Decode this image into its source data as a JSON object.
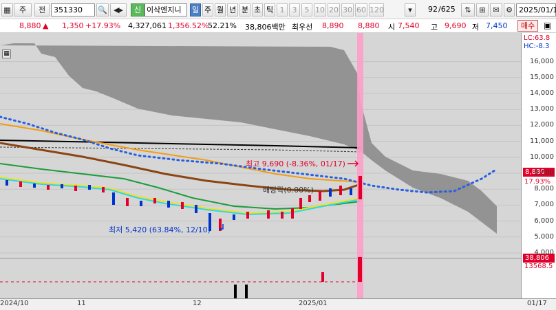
{
  "toolbar": {
    "period_label": "주",
    "period_sub": "전",
    "code": "351330",
    "listing_badge": "신",
    "stock_name": "이삭엔지니",
    "tabs": [
      {
        "label": "일",
        "active": true
      },
      {
        "label": "주",
        "active": false
      },
      {
        "label": "월",
        "active": false
      },
      {
        "label": "년",
        "active": false
      },
      {
        "label": "분",
        "active": false
      },
      {
        "label": "초",
        "active": false
      },
      {
        "label": "틱",
        "active": false
      },
      {
        "label": "1",
        "active": false
      },
      {
        "label": "3",
        "active": false
      },
      {
        "label": "5",
        "active": false
      },
      {
        "label": "10",
        "active": false
      },
      {
        "label": "20",
        "active": false
      },
      {
        "label": "30",
        "active": false
      },
      {
        "label": "60",
        "active": false
      },
      {
        "label": "120",
        "active": false
      }
    ],
    "count_value": "92",
    "count_total": "/625",
    "date": "2025/01/1"
  },
  "quote": {
    "price": "8,880",
    "arrow": "▲",
    "change": "1,350",
    "change_pct": "+17.93%",
    "volume": "4,327,061",
    "volume_ratio": "1,356.52%",
    "turnover": "52.21%",
    "amount": "38,806백만",
    "priority_label": "최우선",
    "best_ask": "8,890",
    "best_bid": "8,880",
    "open_label": "시",
    "open": "7,540",
    "high_label": "고",
    "high": "9,690",
    "low_label": "저",
    "low": "7,450",
    "buy_label": "매수"
  },
  "chart_data": {
    "type": "candlestick",
    "y_ticks": [
      "16,000",
      "15,000",
      "14,000",
      "13,000",
      "12,000",
      "11,000",
      "10,000",
      "9,000",
      "8,000",
      "7,000",
      "6,000",
      "5,000",
      "4,000"
    ],
    "ylim": [
      4000,
      16500
    ],
    "x_labels": [
      "2024/10",
      "11",
      "12",
      "2025/01",
      "01/17"
    ],
    "annotations": {
      "high": "최고 9,690 (-8.36%, 01/17)",
      "low": "최저 5,420 (63.84%, 12/10)",
      "dividend": "배당락(0.00%)"
    },
    "price_tag": "8,880",
    "price_tag_pct": "17.93%",
    "volume_tag": "38,806",
    "volume_tag_sub": "13568.5",
    "lc_label": "LC:63.8",
    "hc_label": "HC:-8.3",
    "colors": {
      "up": "#e0002a",
      "down": "#0033cc",
      "cloud": "#8c8c8c",
      "highlight": "#ff9ec8"
    }
  }
}
